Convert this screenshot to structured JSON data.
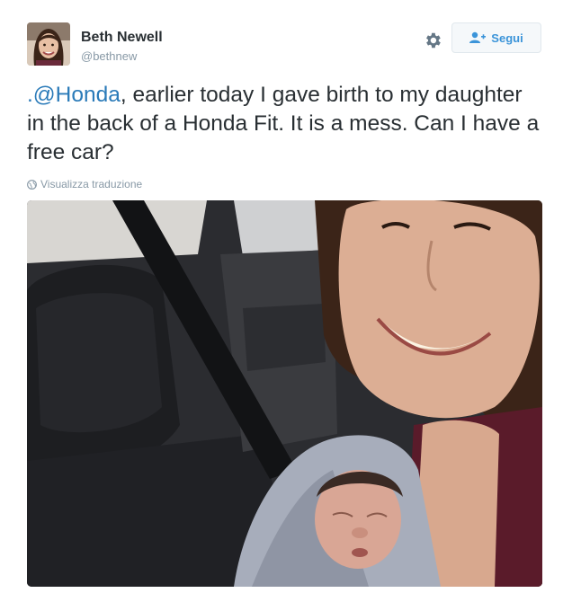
{
  "user": {
    "name": "Beth Newell",
    "handle": "@bethnew"
  },
  "actions": {
    "settings_icon": "gear-icon",
    "follow_icon": "add-user-icon",
    "follow_label": "Segui"
  },
  "tweet": {
    "mention": ".@Honda",
    "text": ", earlier today I gave birth to my daughter in the back of a Honda Fit. It is a mess. Can I have a free car?",
    "translate_label": "Visualizza traduzione",
    "translate_icon": "globe-icon"
  },
  "colors": {
    "link": "#2b7bb9",
    "follow_accent": "#3b94d9",
    "secondary_text": "#8899a6"
  }
}
